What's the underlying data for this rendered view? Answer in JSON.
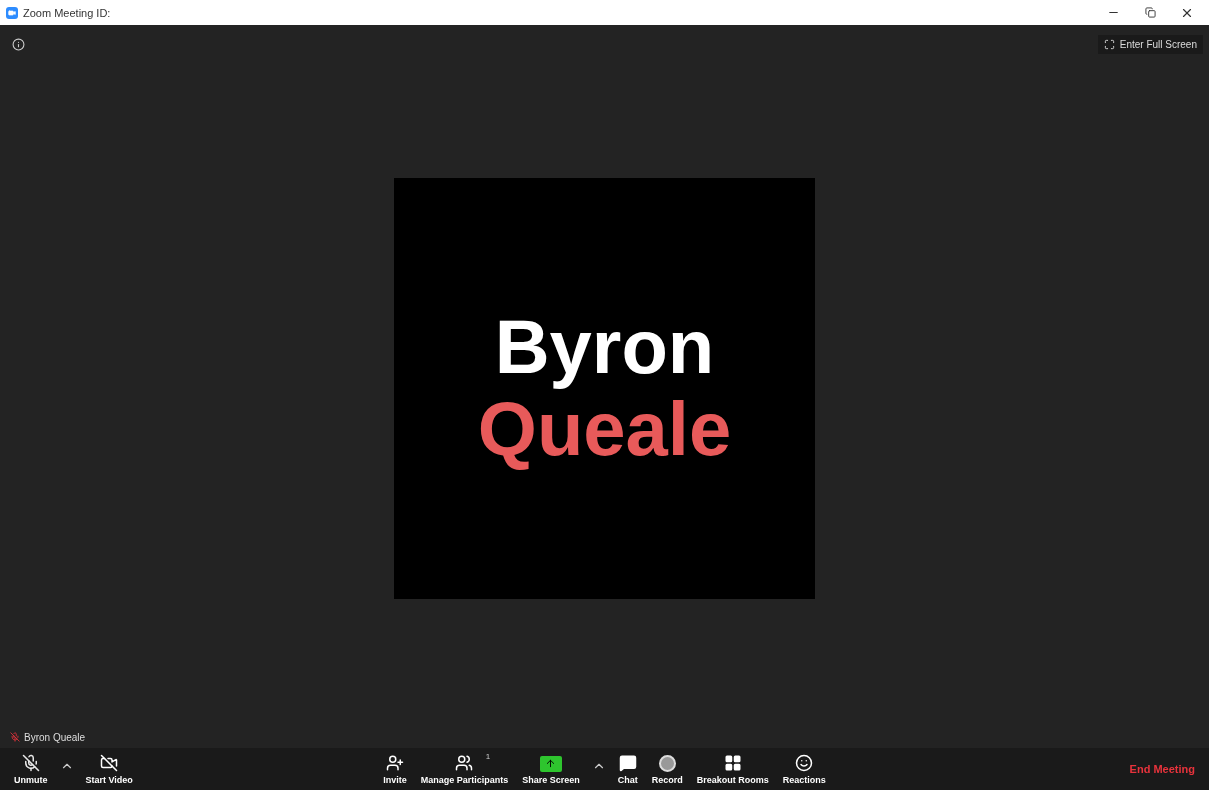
{
  "window": {
    "title": "Zoom Meeting ID:"
  },
  "fullscreen_button": {
    "label": "Enter Full Screen"
  },
  "video_tile": {
    "lines": [
      {
        "text": "Byron",
        "color": "#ffffff"
      },
      {
        "text": "Queale",
        "color": "#e85a5a"
      }
    ]
  },
  "name_label": {
    "text": "Byron Queale",
    "muted": true
  },
  "toolbar": {
    "left": [
      {
        "kind": "mic",
        "label": "Unmute",
        "muted": true,
        "menu": true
      },
      {
        "kind": "video",
        "label": "Start Video",
        "muted": true,
        "menu": false
      }
    ],
    "center": [
      {
        "kind": "invite",
        "label": "Invite",
        "menu": false
      },
      {
        "kind": "participants",
        "label": "Manage Participants",
        "count": "1",
        "menu": false
      },
      {
        "kind": "share",
        "label": "Share Screen",
        "menu": true
      },
      {
        "kind": "chat",
        "label": "Chat",
        "menu": false
      },
      {
        "kind": "record",
        "label": "Record",
        "menu": false
      },
      {
        "kind": "breakout",
        "label": "Breakout Rooms",
        "menu": false
      },
      {
        "kind": "reactions",
        "label": "Reactions",
        "menu": false
      }
    ],
    "end_button": {
      "label": "End Meeting"
    }
  }
}
